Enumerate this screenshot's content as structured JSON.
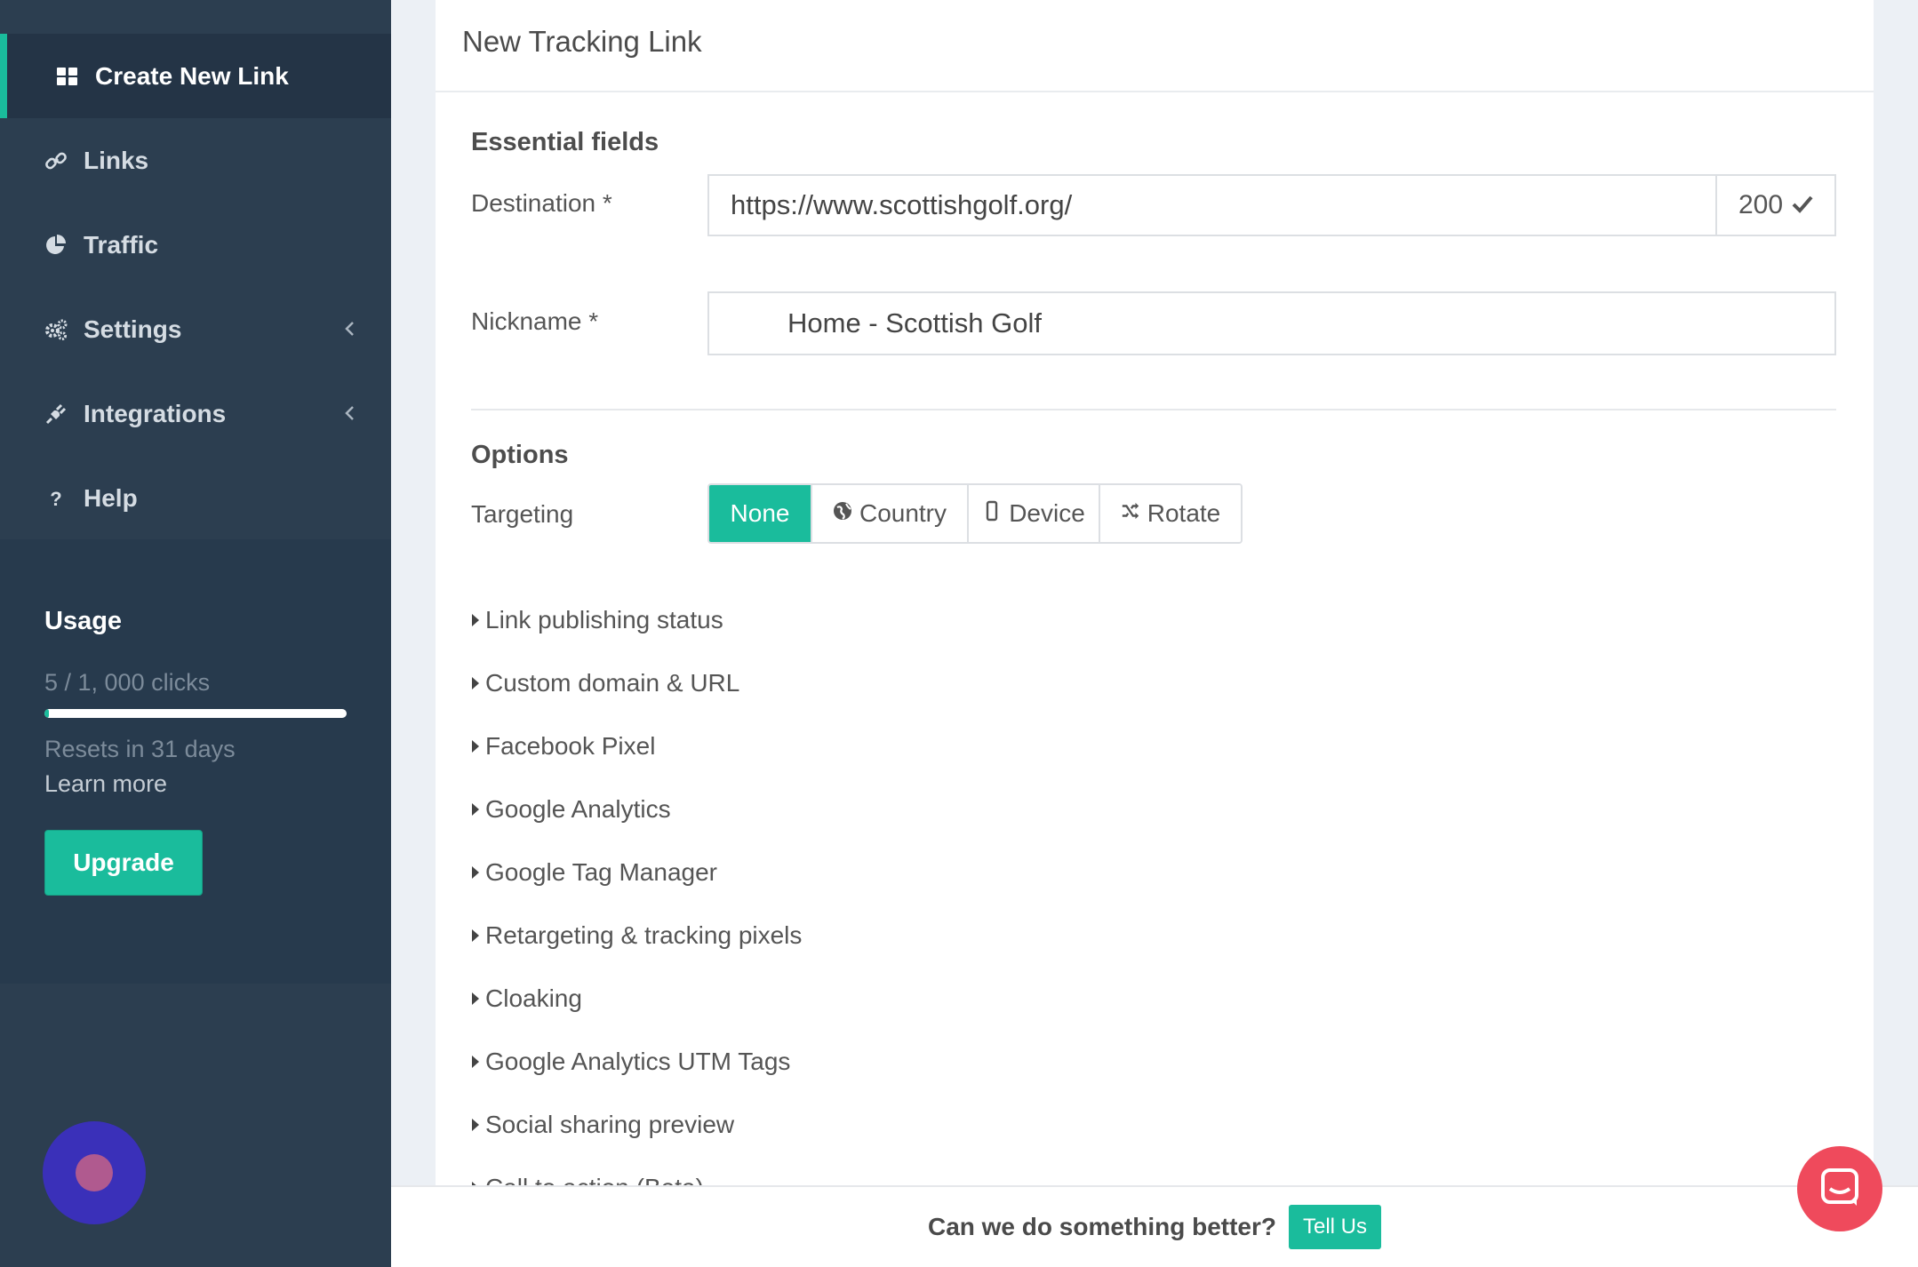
{
  "sidebar": {
    "items": [
      {
        "label": "Create New Link",
        "icon": "grid-icon"
      },
      {
        "label": "Links",
        "icon": "link-icon"
      },
      {
        "label": "Traffic",
        "icon": "pie-chart-icon"
      },
      {
        "label": "Settings",
        "icon": "gears-icon"
      },
      {
        "label": "Integrations",
        "icon": "plug-icon"
      },
      {
        "label": "Help",
        "icon": "question-icon"
      }
    ],
    "usage": {
      "title": "Usage",
      "clicks": "5 / 1, 000 clicks",
      "progress_fraction": 0.005,
      "resets": "Resets in 31 days",
      "learn_more": "Learn more",
      "upgrade": "Upgrade"
    }
  },
  "main": {
    "title": "New Tracking Link",
    "essential_title": "Essential fields",
    "destination_label": "Destination *",
    "destination_value": "https://www.scottishgolf.org/",
    "destination_status": "200",
    "nickname_label": "Nickname *",
    "nickname_value": "Home - Scottish Golf",
    "options_title": "Options",
    "targeting_label": "Targeting",
    "targeting_options": [
      "None",
      "Country",
      "Device",
      "Rotate"
    ],
    "targeting_selected": "None",
    "sections": [
      "Link publishing status",
      "Custom domain & URL",
      "Facebook Pixel",
      "Google Analytics",
      "Google Tag Manager",
      "Retargeting & tracking pixels",
      "Cloaking",
      "Google Analytics UTM Tags",
      "Social sharing preview",
      "Call to action (Beta)"
    ]
  },
  "feedback": {
    "question": "Can we do something better?",
    "button": "Tell Us"
  },
  "colors": {
    "sidebar_bg": "#2c3e50",
    "accent": "#1abc9c",
    "chat": "#ef4a5c"
  }
}
